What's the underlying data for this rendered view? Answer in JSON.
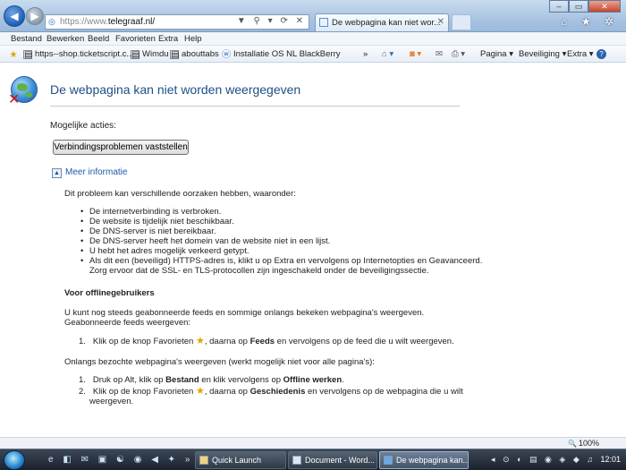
{
  "browser": {
    "url_prefix": "https://www.",
    "url_domain": "telegraaf.nl/",
    "address_tools": "▼ ⚲ ▾ ⟳ ✕",
    "tab_title": "De webpagina kan niet wor...",
    "fav_icons": "⌂ ★ ✲"
  },
  "menu": [
    "Bestand",
    "Bewerken",
    "Beeld",
    "Favorieten",
    "Extra",
    "Help"
  ],
  "favorites_bar": [
    {
      "label": "https--shop.ticketscript.c...",
      "icon": "page-icon"
    },
    {
      "label": "Wimdu",
      "icon": "page-icon"
    },
    {
      "label": "abouttabs",
      "icon": "page-icon"
    },
    {
      "label": "Installatie OS  NL BlackBerry",
      "icon": "web-icon"
    }
  ],
  "command_bar": {
    "overflow": "»",
    "pagina": "Pagina ▾",
    "beveiliging": "Beveiliging ▾",
    "extra": "Extra ▾",
    "help": "?"
  },
  "error_page": {
    "title": "De webpagina kan niet worden weergegeven",
    "possible_actions": "Mogelijke acties:",
    "diagnose_button": "Verbindingsproblemen vaststellen",
    "more_info": "Meer informatie",
    "intro": "Dit probleem kan verschillende oorzaken hebben, waaronder:",
    "causes": [
      "De internetverbinding is verbroken.",
      "De website is tijdelijk niet beschikbaar.",
      "De DNS-server is niet bereikbaar.",
      "De DNS-server heeft het domein van de website niet in een lijst.",
      "U hebt het adres mogelijk verkeerd getypt.",
      "Als dit een (beveiligd) HTTPS-adres is, klikt u op Extra en vervolgens op Internetopties en Geavanceerd.",
      "Zorg ervoor dat de SSL- en TLS-protocollen zijn ingeschakeld onder de beveiligingssectie."
    ],
    "offline_heading": "Voor offlinegebruikers",
    "offline_p1": "U kunt nog steeds geabonneerde feeds en sommige onlangs bekeken webpagina's weergeven.",
    "offline_p2": "Geabonneerde feeds weergeven:",
    "feeds_step": {
      "n": "1.",
      "a": "Klik op de knop Favorieten ",
      "b": ", daarna op ",
      "bold": "Feeds",
      "c": " en vervolgens op de feed die u wilt weergeven."
    },
    "recent_heading": "Onlangs bezochte webpagina's weergeven (werkt mogelijk niet voor alle pagina's):",
    "recent_step1": {
      "n": "1.",
      "a": "Druk op Alt, klik op ",
      "bold1": "Bestand",
      "b": " en klik vervolgens op ",
      "bold2": "Offline werken",
      "c": "."
    },
    "recent_step2": {
      "n": "2.",
      "a": "Klik op de knop Favorieten ",
      "b": ", daarna op ",
      "bold": "Geschiedenis",
      "c": " en vervolgens op de webpagina die u wilt",
      "d": "weergeven."
    }
  },
  "status": {
    "zoom": "100%"
  },
  "taskbar": {
    "quick_launch": "e ◧ ✉ ▣ ☯ ◉ ◀ ✦ »",
    "buttons": [
      "Quick Launch",
      "Document - Word...",
      "De webpagina kan..."
    ],
    "tray": "◂ ⊙ ◐ ▤ ◉ ◈ ◆ ♫",
    "clock": "12:01"
  }
}
